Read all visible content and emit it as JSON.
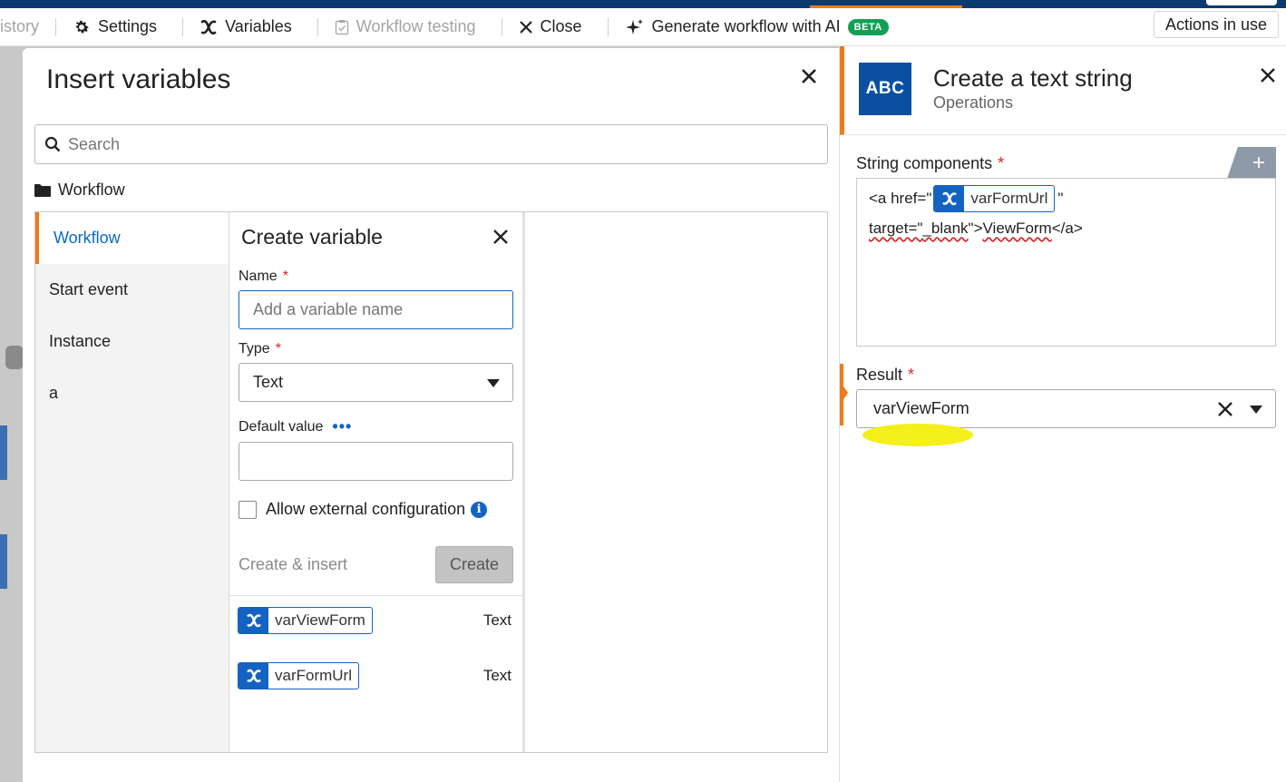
{
  "toolbar": {
    "history_label": "istory",
    "settings_label": "Settings",
    "variables_label": "Variables",
    "testing_label": "Workflow testing",
    "close_label": "Close",
    "ai_label": "Generate workflow with AI",
    "beta_badge": "BETA",
    "actions_label": "Actions in use"
  },
  "insert_variables": {
    "title": "Insert variables",
    "search_placeholder": "Search",
    "folder_label": "Workflow",
    "nav": [
      {
        "label": "Workflow",
        "active": true
      },
      {
        "label": "Start event"
      },
      {
        "label": "Instance"
      },
      {
        "label": "a"
      }
    ]
  },
  "create_variable": {
    "title": "Create variable",
    "name_label": "Name",
    "name_placeholder": "Add a variable name",
    "type_label": "Type",
    "type_value": "Text",
    "default_label": "Default value",
    "default_menu": "•••",
    "allow_external_label": "Allow external configuration",
    "create_insert_label": "Create & insert",
    "create_label": "Create",
    "required_mark": "*"
  },
  "variables": [
    {
      "name": "varViewForm",
      "type": "Text"
    },
    {
      "name": "varFormUrl",
      "type": "Text"
    }
  ],
  "action_panel": {
    "icon_text": "ABC",
    "title": "Create a text string",
    "subtitle": "Operations",
    "string_components_label": "String components",
    "required_mark": "*",
    "add_symbol": "+",
    "line1_prefix": "<a href=\"",
    "line1_chip": "varFormUrl",
    "line1_suffix": "\"",
    "line2_part1": "target=\"",
    "line2_part2": "_blank",
    "line2_part3": "\">",
    "line2_part4": "ViewForm",
    "line2_part5": "</a>",
    "result_label": "Result",
    "result_value": "varViewForm"
  },
  "colors": {
    "brand_navy": "#0b3b6e",
    "accent_orange": "#f07a1a",
    "link_blue": "#1463c2",
    "beta_green": "#14a054",
    "highlight_yellow": "#f4ee10"
  }
}
